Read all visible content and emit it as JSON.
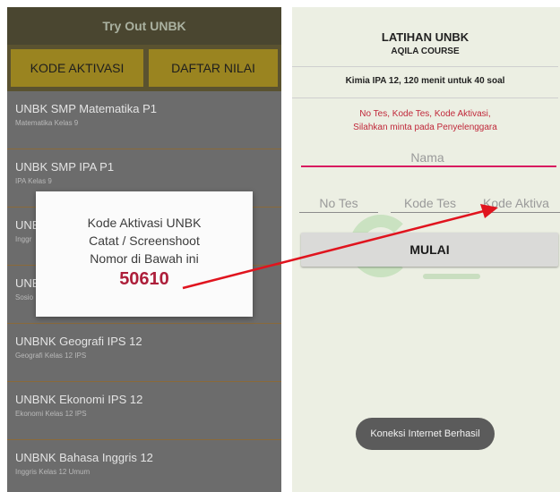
{
  "left": {
    "title": "Try Out UNBK",
    "tabs": [
      "KODE AKTIVASI",
      "DAFTAR NILAI"
    ],
    "items": [
      {
        "title": "UNBK SMP Matematika P1",
        "subtitle": "Matematika Kelas 9"
      },
      {
        "title": "UNBK SMP IPA P1",
        "subtitle": "IPA Kelas 9"
      },
      {
        "title": "UNE",
        "subtitle": "Inggr"
      },
      {
        "title": "UNE",
        "subtitle": "Sosio"
      },
      {
        "title": "UNBNK Geografi IPS 12",
        "subtitle": "Geografi Kelas 12 IPS"
      },
      {
        "title": "UNBNK Ekonomi IPS 12",
        "subtitle": "Ekonomi Kelas 12 IPS"
      },
      {
        "title": "UNBNK Bahasa Inggris 12",
        "subtitle": "Inggris Kelas 12 Umum"
      }
    ],
    "dialog": {
      "line1": "Kode Aktivasi UNBK",
      "line2": "Catat / Screenshoot",
      "line3": "Nomor di Bawah ini",
      "code": "50610"
    }
  },
  "right": {
    "heading": "LATIHAN UNBK",
    "subheading": "AQILA COURSE",
    "subject": "Kimia IPA 12, 120 menit untuk 40 soal",
    "note_line1": "No Tes, Kode Tes, Kode Aktivasi,",
    "note_line2": "Silahkan minta pada Penyelenggara",
    "fields": {
      "nama_placeholder": "Nama",
      "no_tes_placeholder": "No Tes",
      "kode_tes_placeholder": "Kode Tes",
      "kode_aktivasi_placeholder": "Kode Aktiva"
    },
    "button": "MULAI",
    "toast": "Koneksi Internet Berhasil"
  },
  "colors": {
    "accent": "#d81b60",
    "code": "#ad1e3a",
    "arrow": "#e0141e",
    "tab": "#9a8420"
  }
}
